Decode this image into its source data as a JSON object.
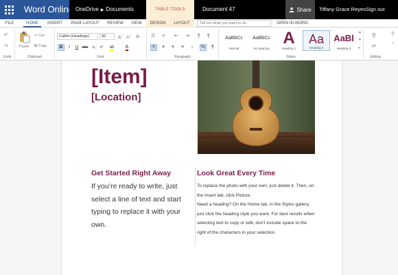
{
  "titlebar": {
    "app_name": "Word Online",
    "location": "OneDrive",
    "folder": "Documents",
    "context_group": "TABLE TOOLS",
    "document_name": "Document 47",
    "share_label": "Share",
    "user_name": "Tiffany Grace Reyes",
    "signout_label": "Sign out"
  },
  "tabs": [
    "FILE",
    "HOME",
    "INSERT",
    "PAGE LAYOUT",
    "REVIEW",
    "VIEW",
    "DESIGN",
    "LAYOUT"
  ],
  "tell_me_placeholder": "Tell me what you want to do",
  "open_in_word": "OPEN IN WORD",
  "ribbon": {
    "undo_label": "Undo",
    "paste_label": "Paste",
    "cut_label": "Cut",
    "copy_label": "Copy",
    "clipboard_label": "Clipboard",
    "font_name": "Calibri (Headings)",
    "font_size": "50",
    "font_label": "Font",
    "paragraph_label": "Paragraph",
    "styles_label": "Styles",
    "editing_label": "Editing",
    "styles": [
      {
        "sample": "AaBbCc",
        "name": "Normal"
      },
      {
        "sample": "AaBbCc",
        "name": "No Spacing"
      },
      {
        "sample": "A",
        "name": "Heading 1"
      },
      {
        "sample": "Aa",
        "name": "Heading 2"
      },
      {
        "sample": "AaBl",
        "name": "Heading 3"
      }
    ],
    "accent_color": "#7b1c4a",
    "highlight_color": "#ffff00",
    "font_color": "#c00000"
  },
  "document": {
    "title": "[Item]",
    "subtitle": "[Location]",
    "left_heading": "Get Started Right Away",
    "left_body": "If you’re ready to write, just select a line of text and start typing to replace it with your own.",
    "right_heading": "Look Great Every Time",
    "right_body_1": "To replace the photo with your own, just delete it. Then, on the Insert tab, click Picture.",
    "right_body_2": "Need a heading? On the Home tab, in the Styles gallery, just click the heading style you want. For best results when selecting text to copy or edit, don’t include space to the right of the characters in your selection."
  }
}
